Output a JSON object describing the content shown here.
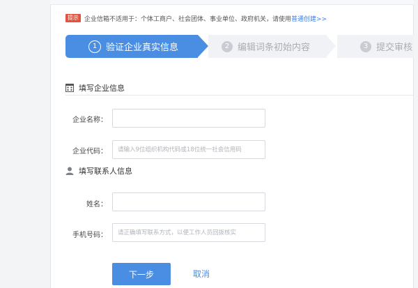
{
  "notice": {
    "tag": "提示",
    "text": "企业信箱不适用于：个体工商户、社会团体、事业单位、政府机关，请使用",
    "link": "普通创建>>"
  },
  "steps": [
    {
      "number": "1",
      "label": "验证企业真实信息",
      "state": "active"
    },
    {
      "number": "2",
      "label": "编辑词条初始内容",
      "state": "inactive"
    },
    {
      "number": "3",
      "label": "提交审核",
      "state": "inactive"
    }
  ],
  "company_section": {
    "title": "填写企业信息",
    "name_label": "企业名称：",
    "name_value": "",
    "code_label": "企业代码：",
    "code_placeholder": "请输入9位组织机构代码或18位统一社会信用码"
  },
  "contact_section": {
    "title": "填写联系人信息",
    "name_label": "姓名：",
    "name_value": "",
    "phone_label": "手机号码：",
    "phone_placeholder": "请正确填写联系方式，以便工作人员回拨核实"
  },
  "actions": {
    "next": "下一步",
    "cancel": "取消"
  },
  "colors": {
    "accent": "#4a8ee3",
    "tag_red": "#e2533f",
    "inactive_step_bg": "#f1f2f5"
  },
  "icons": {
    "company_section": "building-icon",
    "contact_section": "user-icon"
  }
}
